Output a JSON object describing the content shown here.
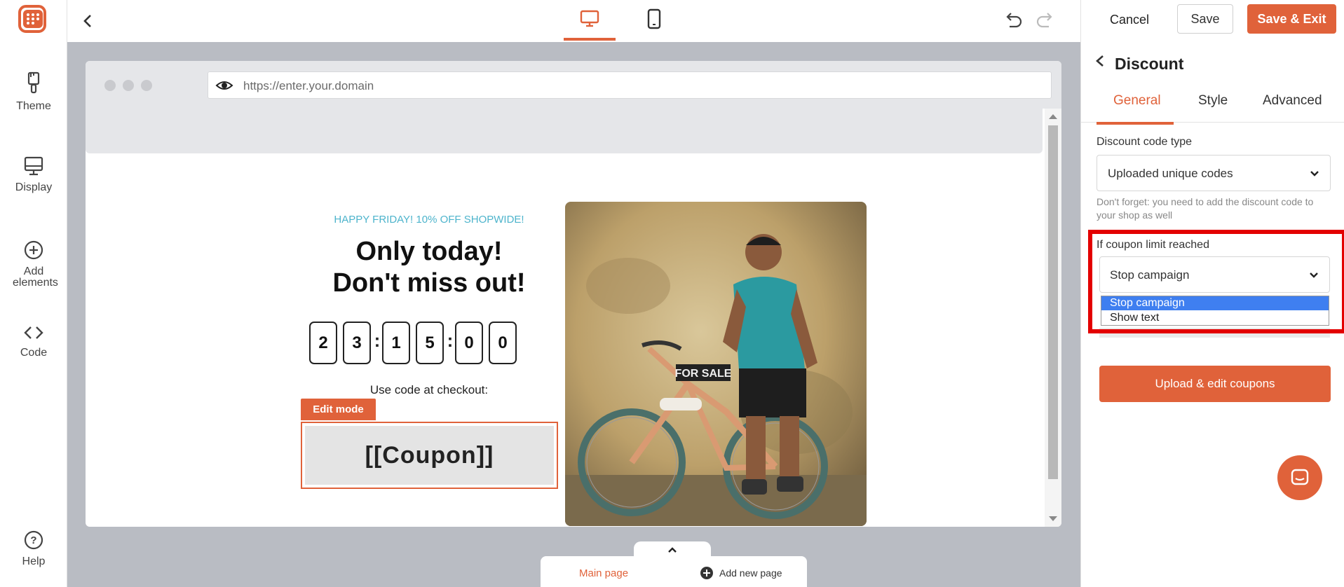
{
  "colors": {
    "accent": "#e0623a",
    "highlight": "#e30000",
    "selected_option": "#3f7ff0",
    "promo_subtitle": "#4db4cc"
  },
  "sidebar": {
    "items": [
      {
        "label": "Theme",
        "icon": "paintbrush-icon"
      },
      {
        "label": "Display",
        "icon": "monitor-icon"
      },
      {
        "label": "Add elements",
        "icon": "plus-circle-icon"
      },
      {
        "label": "Code",
        "icon": "code-icon"
      }
    ],
    "help_label": "Help"
  },
  "toolbar": {
    "cancel_label": "Cancel",
    "save_label": "Save",
    "save_exit_label": "Save & Exit"
  },
  "preview": {
    "url": "https://enter.your.domain",
    "subtitle": "HAPPY FRIDAY! 10% OFF SHOPWIDE!",
    "title_line1": "Only today!",
    "title_line2": "Don't miss out!",
    "countdown": [
      "2",
      "3",
      "1",
      "5",
      "0",
      "0"
    ],
    "use_code_text": "Use code at checkout:",
    "coupon_placeholder": "[[Coupon]]",
    "edit_mode_label": "Edit mode",
    "image_sign_text": "FOR SALE"
  },
  "pages": {
    "main_page": "Main page",
    "add_new_page": "Add new page"
  },
  "panel": {
    "title": "Discount",
    "tabs": [
      "General",
      "Style",
      "Advanced"
    ],
    "active_tab": "General",
    "discount_code_type_label": "Discount code type",
    "discount_code_type_value": "Uploaded unique codes",
    "hint": "Don't forget: you need to add the discount code to your shop as well",
    "coupon_limit_label": "If coupon limit reached",
    "coupon_limit_value": "Stop campaign",
    "coupon_limit_options": [
      "Stop campaign",
      "Show text"
    ],
    "upload_button": "Upload & edit coupons"
  }
}
